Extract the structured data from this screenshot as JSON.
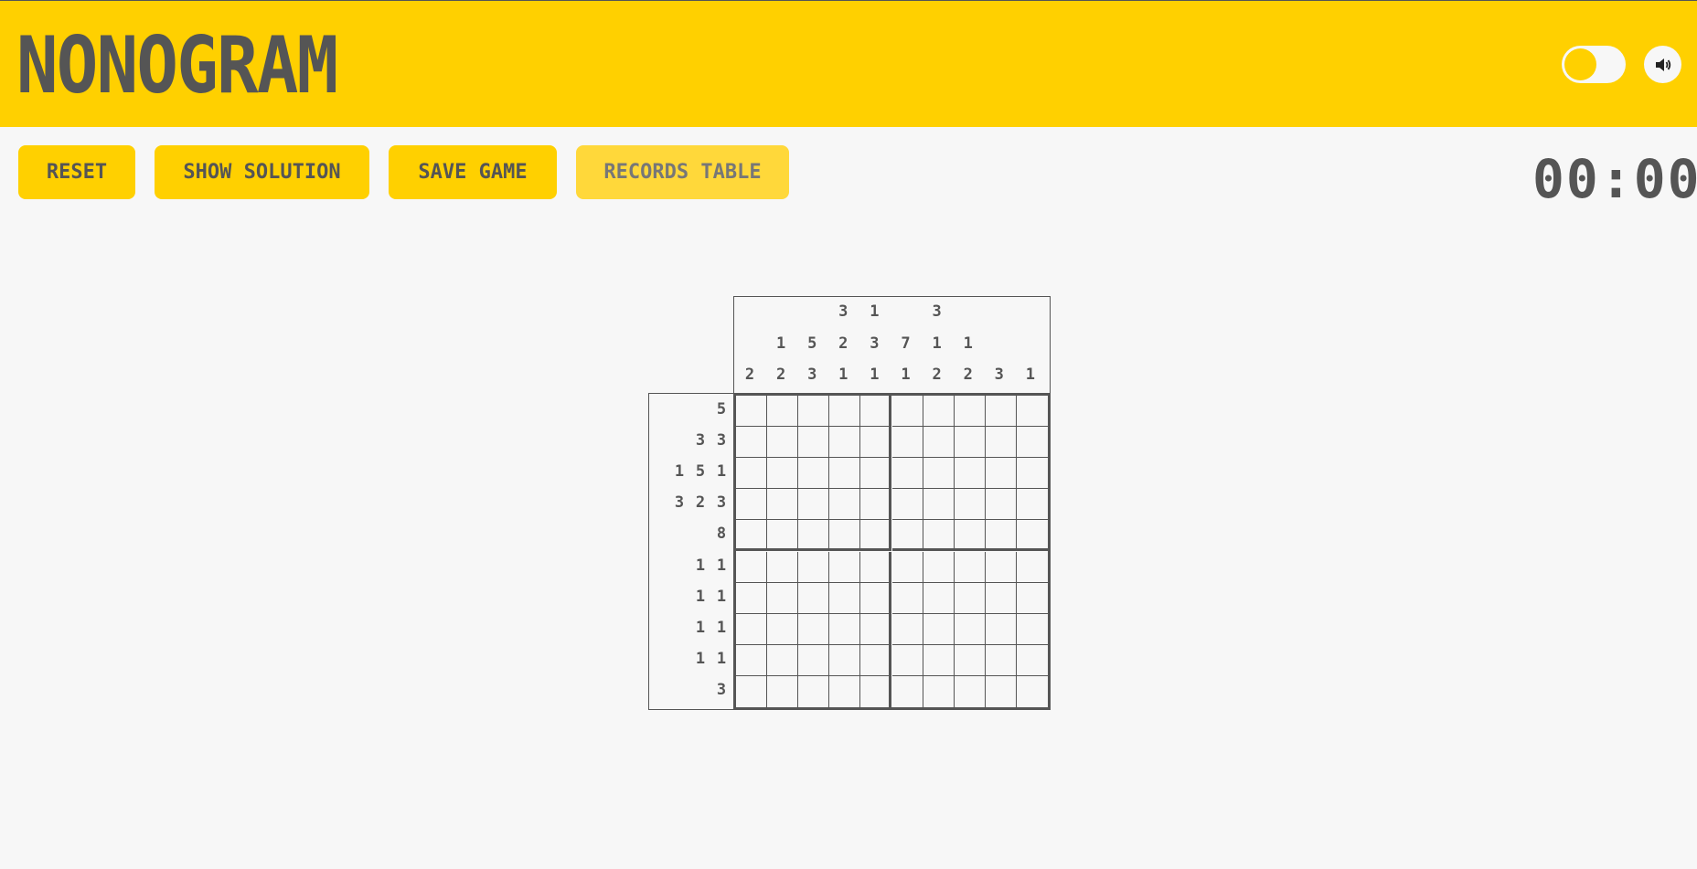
{
  "header": {
    "title": "NONOGRAM",
    "theme_toggle_icon": "theme-toggle-switch",
    "sound_icon": "speaker-icon"
  },
  "toolbar": {
    "reset_label": "RESET",
    "show_solution_label": "SHOW SOLUTION",
    "save_game_label": "SAVE GAME",
    "records_table_label": "RECORDS TABLE"
  },
  "timer": "00:00",
  "colors": {
    "accent": "#ffd000",
    "text": "#555555",
    "background": "#f7f7f7"
  },
  "puzzle": {
    "size": 10,
    "column_clues": [
      [
        "2"
      ],
      [
        "1",
        "2"
      ],
      [
        "5",
        "3"
      ],
      [
        "3",
        "2",
        "1"
      ],
      [
        "1",
        "3",
        "1"
      ],
      [
        "7",
        "1"
      ],
      [
        "3",
        "1",
        "2"
      ],
      [
        "1",
        "2"
      ],
      [
        "3"
      ],
      [
        "1"
      ]
    ],
    "row_clues": [
      [
        "5"
      ],
      [
        "3",
        "3"
      ],
      [
        "1",
        "5",
        "1"
      ],
      [
        "3",
        "2",
        "3"
      ],
      [
        "8"
      ],
      [
        "1",
        "1"
      ],
      [
        "1",
        "1"
      ],
      [
        "1",
        "1"
      ],
      [
        "1",
        "1"
      ],
      [
        "3"
      ]
    ]
  }
}
